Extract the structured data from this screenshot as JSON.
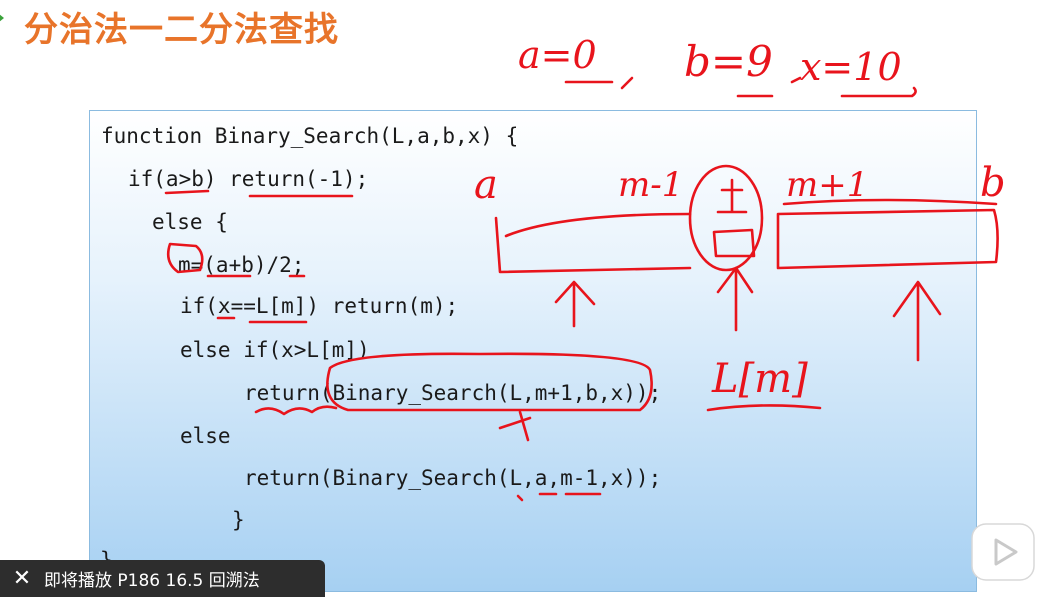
{
  "slide": {
    "title": "分治法一二分法查找"
  },
  "code": {
    "lines": [
      "function Binary_Search(L,a,b,x) {",
      "if(a>b) return(-1);",
      "else {",
      "m=(a+b)/2;",
      "if(x==L[m]) return(m);",
      "else if(x>L[m])",
      "return(Binary_Search(L,m+1,b,x));",
      "else",
      "return(Binary_Search(L,a,m-1,x));",
      "}",
      "}"
    ]
  },
  "annotations": {
    "a_eq": "a=0",
    "b_eq": "b=9",
    "x_eq": "x=10",
    "label_a": "a",
    "label_m_minus_1": "m-1",
    "label_m_plus_1": "m+1",
    "label_b": "b",
    "label_Lm": "L[m]"
  },
  "toast": {
    "close_icon": "close-icon",
    "text": "即将播放 P186 16.5 回溯法"
  },
  "player": {
    "icon": "bilibili-play-icon",
    "accent": "#ffffff"
  }
}
